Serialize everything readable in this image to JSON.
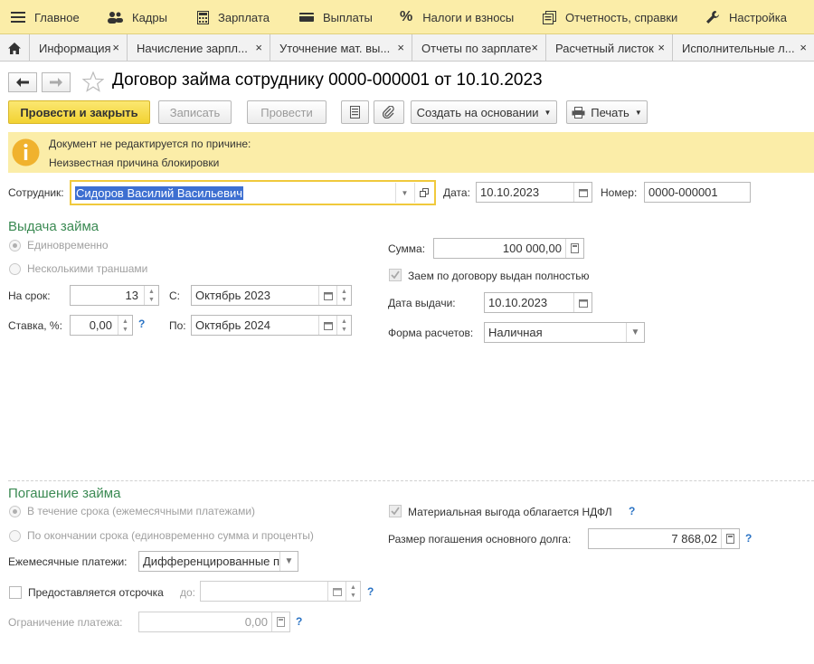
{
  "top_menu": [
    {
      "label": "Главное",
      "icon": "hamburger-icon"
    },
    {
      "label": "Кадры",
      "icon": "users-icon"
    },
    {
      "label": "Зарплата",
      "icon": "calculator-icon"
    },
    {
      "label": "Выплаты",
      "icon": "wallet-icon"
    },
    {
      "label": "Налоги и взносы",
      "icon": "percent-icon"
    },
    {
      "label": "Отчетность, справки",
      "icon": "reports-icon"
    },
    {
      "label": "Настройка",
      "icon": "wrench-icon"
    }
  ],
  "tabs": [
    {
      "label": "Информация"
    },
    {
      "label": "Начисление зарпл..."
    },
    {
      "label": "Уточнение мат. вы..."
    },
    {
      "label": "Отчеты по зарплате"
    },
    {
      "label": "Расчетный листок"
    },
    {
      "label": "Исполнительные л..."
    }
  ],
  "tab_close": "×",
  "document": {
    "title": "Договор займа сотруднику 0000-000001 от 10.10.2023"
  },
  "toolbar": {
    "post_close": "Провести и закрыть",
    "save": "Записать",
    "post": "Провести",
    "create_based": "Создать на основании",
    "print": "Печать"
  },
  "info_panel": {
    "line1": "Документ не редактируется по причине:",
    "line2": "Неизвестная причина блокировки"
  },
  "header_fields": {
    "employee_label": "Сотрудник:",
    "employee_value": "Сидоров Василий Васильевич",
    "date_label": "Дата:",
    "date_value": "10.10.2023",
    "number_label": "Номер:",
    "number_value": "0000-000001"
  },
  "issue": {
    "section_title": "Выдача займа",
    "radio_once": "Единовременно",
    "radio_tranches": "Несколькими траншами",
    "term_label": "На срок:",
    "term_value": "13",
    "from_label": "С:",
    "from_value": "Октябрь 2023",
    "rate_label": "Ставка, %:",
    "rate_value": "0,00",
    "to_label": "По:",
    "to_value": "Октябрь 2024",
    "sum_label": "Сумма:",
    "sum_value": "100 000,00",
    "fully_issued_label": "Заем по договору выдан полностью",
    "issue_date_label": "Дата выдачи:",
    "issue_date_value": "10.10.2023",
    "payment_form_label": "Форма расчетов:",
    "payment_form_value": "Наличная"
  },
  "repayment": {
    "section_title": "Погашение займа",
    "radio_monthly": "В течение срока (ежемесячными платежами)",
    "radio_end": "По окончании срока (единовременно сумма и проценты)",
    "monthly_label": "Ежемесячные платежи:",
    "monthly_value": "Дифференцированные пл",
    "deferral_label": "Предоставляется отсрочка",
    "deferral_to_label": "до:",
    "limit_label": "Ограничение платежа:",
    "limit_value": "0,00",
    "material_benefit_label": "Материальная выгода облагается НДФЛ",
    "principal_label": "Размер погашения основного долга:",
    "principal_value": "7 868,02"
  },
  "help_mark": "?",
  "colors": {
    "menu_bg": "#fbeda8",
    "primary_button": "#f2d232",
    "section_title": "#3b8a53",
    "help": "#2a73c4",
    "selection": "#3d6fd1"
  }
}
